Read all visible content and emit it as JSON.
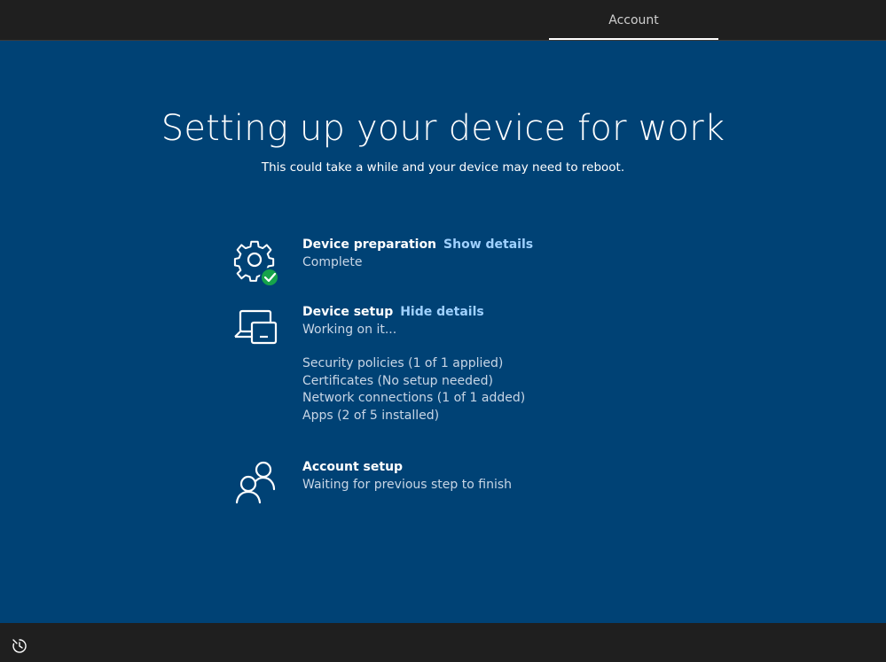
{
  "topbar": {
    "tab_label": "Account"
  },
  "main": {
    "title": "Setting up your device for work",
    "subtitle": "This could take a while and your device may need to reboot.",
    "steps": [
      {
        "icon": "gear-check-icon",
        "title": "Device preparation",
        "link": "Show details",
        "status": "Complete"
      },
      {
        "icon": "devices-icon",
        "title": "Device setup",
        "link": "Hide details",
        "status": "Working on it...",
        "details": [
          "Security policies (1 of 1 applied)",
          "Certificates (No setup needed)",
          "Network connections (1 of 1 added)",
          "Apps (2 of 5 installed)"
        ]
      },
      {
        "icon": "people-icon",
        "title": "Account setup",
        "status": "Waiting for previous step to finish"
      }
    ]
  },
  "bottombar": {
    "icon": "ease-of-access-icon"
  },
  "colors": {
    "background": "#004275",
    "bar": "#1f1f1f",
    "link": "#9fd1ff",
    "success": "#16a34a"
  }
}
